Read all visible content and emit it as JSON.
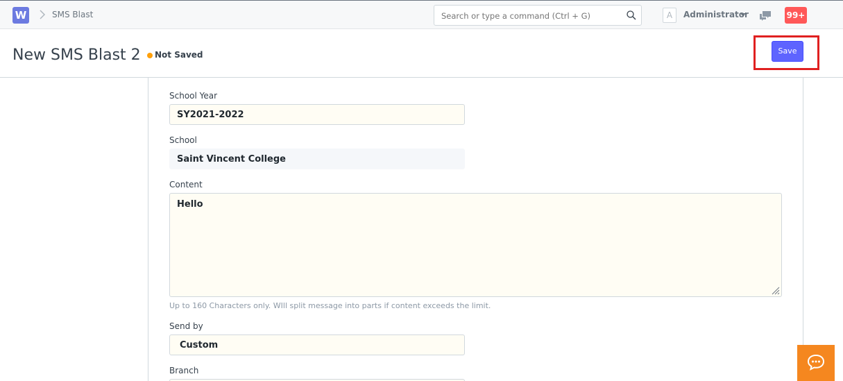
{
  "navbar": {
    "logo_letter": "W",
    "breadcrumb": "SMS Blast",
    "search_placeholder": "Search or type a command (Ctrl + G)",
    "avatar_letter": "A",
    "user_name": "Administrator",
    "notifications": "99+"
  },
  "page": {
    "title": "New SMS Blast 2",
    "status": "Not Saved",
    "save_label": "Save"
  },
  "form": {
    "school_year": {
      "label": "School Year",
      "value": "SY2021-2022"
    },
    "school": {
      "label": "School",
      "value": "Saint Vincent College"
    },
    "content": {
      "label": "Content",
      "value": "Hello",
      "help": "Up to 160 Characters only. WIll split message into parts if content exceeds the limit."
    },
    "send_by": {
      "label": "Send by",
      "value": "Custom"
    },
    "branch": {
      "label": "Branch"
    }
  },
  "colors": {
    "primary": "#5e64ff",
    "status_dot": "#ffa00a",
    "badge": "#ff5858",
    "highlight": "#e02020",
    "chat_fab": "#f5871f"
  }
}
